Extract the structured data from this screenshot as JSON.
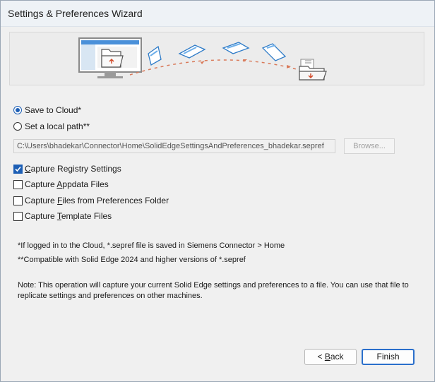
{
  "window": {
    "title": "Settings & Preferences Wizard"
  },
  "options": {
    "save_to_cloud": {
      "label": "Save to Cloud*",
      "checked": true
    },
    "local_path": {
      "label": "Set a local path**",
      "checked": false
    },
    "path_value": "C:\\Users\\bhadekar\\Connector\\Home\\SolidEdgeSettingsAndPreferences_bhadekar.sepref",
    "browse_label": "Browse..."
  },
  "captures": [
    {
      "pre": "",
      "u": "C",
      "post": "apture Registry Settings",
      "checked": true
    },
    {
      "pre": "Capture ",
      "u": "A",
      "post": "ppdata Files",
      "checked": false
    },
    {
      "pre": "Capture ",
      "u": "F",
      "post": "iles from Preferences Folder",
      "checked": false
    },
    {
      "pre": "Capture ",
      "u": "T",
      "post": "emplate Files",
      "checked": false
    }
  ],
  "notes": {
    "cloud": "*If logged in to the Cloud, *.sepref file is saved in Siemens Connector > Home",
    "compat": "**Compatible with Solid Edge 2024 and higher versions of *.sepref",
    "info": "Note: This operation will capture your current Solid Edge settings and preferences to a file. You can use that file to replicate settings and preferences on other machines."
  },
  "buttons": {
    "back": {
      "pre": "< ",
      "u": "B",
      "post": "ack"
    },
    "finish": "Finish"
  },
  "colors": {
    "accent": "#1d5fb5",
    "window_bg": "#f0f0f0"
  }
}
